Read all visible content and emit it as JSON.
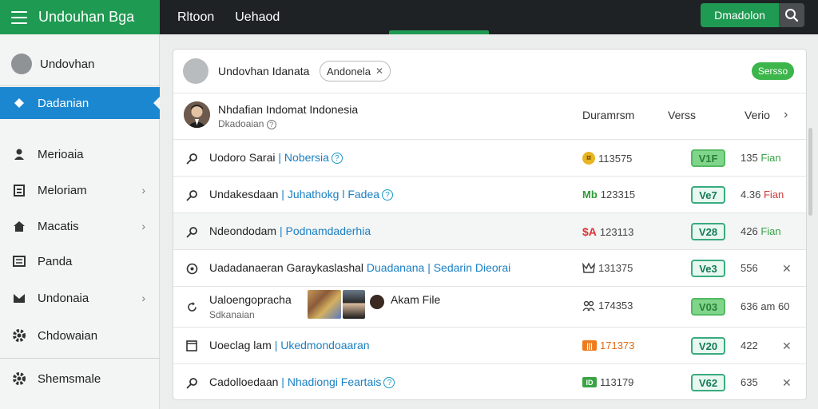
{
  "brand": {
    "title": "Undouhan Bga"
  },
  "topnav": {
    "items": [
      "Rltoon",
      "Uehaod"
    ],
    "button_label": "Dmadolon"
  },
  "sidebar": {
    "items": [
      {
        "label": "Undovhan",
        "icon": "user-circle-icon"
      },
      {
        "label": "Dadanian",
        "icon": "pin-icon",
        "active": true
      },
      {
        "label": "Merioaia",
        "icon": "person-icon"
      },
      {
        "label": "Meloriam",
        "icon": "clipboard-icon",
        "chevron": true
      },
      {
        "label": "Macatis",
        "icon": "home-icon",
        "chevron": true
      },
      {
        "label": "Panda",
        "icon": "list-icon"
      },
      {
        "label": "Undonaia",
        "icon": "mail-icon",
        "chevron": true
      },
      {
        "label": "Chdowaian",
        "icon": "gear-icon"
      },
      {
        "label": "Shemsmale",
        "icon": "gear-icon"
      }
    ]
  },
  "card": {
    "header": {
      "title": "Undovhan Idanata",
      "chip": "Andonela",
      "badge": "Sersso"
    },
    "profile": {
      "name": "Nhdafian Indomat Indonesia",
      "sub": "Dkadoaian",
      "columns": [
        "Duramrsm",
        "Verss",
        "Verio"
      ]
    },
    "rows": [
      {
        "title": "Uodoro Sarai",
        "link": "Nobersia",
        "info": true,
        "num": "113575",
        "badge": "V1F",
        "badge_solid": true,
        "val": "135",
        "val_tail": "Fian",
        "tail_color": "g",
        "icon": "search-icon",
        "mark": "coin"
      },
      {
        "title": "Undakesdaan",
        "link": "Juhathokg l Fadea",
        "info": true,
        "num": "123315",
        "badge": "Ve7",
        "val": "4.36",
        "val_tail": "Fian",
        "tail_color": "r",
        "icon": "search-icon",
        "mark": "Mb"
      },
      {
        "title": "Ndeondodam",
        "link": "Podnamdaderhia",
        "num": "123113",
        "badge": "V28",
        "val": "426",
        "val_tail": "Fian",
        "tail_color": "g",
        "icon": "search-icon",
        "mark": "dollar"
      },
      {
        "title": "Uadadanaeran Garaykaslashal",
        "link": "Duadanana | Sedarin Dieorai",
        "num": "131375",
        "badge": "Ve3",
        "val": "556",
        "close": true,
        "icon": "target-icon",
        "mark": "crown"
      },
      {
        "title": "Ualoengopracha",
        "sub": "Sdkanaian",
        "extra": "Akam File",
        "num": "174353",
        "badge": "V03",
        "badge_solid": true,
        "val": "636",
        "val_tail": "am 60",
        "icon": "refresh-icon",
        "mark": "people"
      },
      {
        "title": "Uoeclag lam",
        "link": "Ukedmondoaaran",
        "num": "171373",
        "badge": "V20",
        "val": "422",
        "close": true,
        "icon": "square-icon",
        "mark": "box"
      },
      {
        "title": "Cadolloedaan",
        "link": "Nhadiongi Feartais",
        "info": true,
        "num": "113179",
        "badge": "V62",
        "val": "635",
        "close": true,
        "icon": "search-icon",
        "mark": "tag"
      }
    ]
  },
  "colors": {
    "brand": "#1f9a52",
    "active": "#1b87d0",
    "link": "#1a7fc3"
  }
}
